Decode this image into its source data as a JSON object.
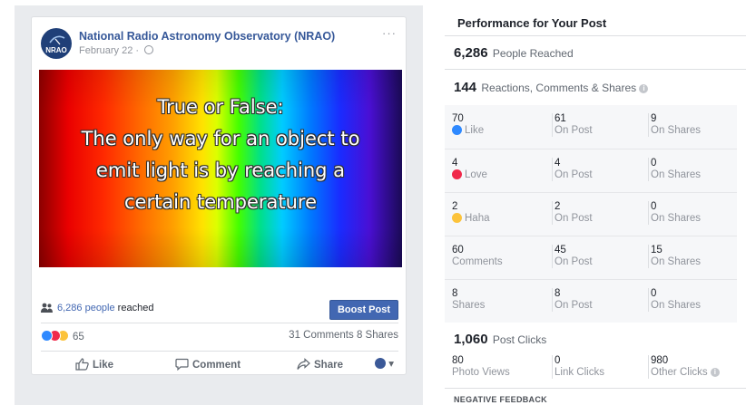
{
  "post": {
    "page_name": "National Radio Astronomy Observatory (NRAO)",
    "date": "February 22 · ",
    "avatar_text": "NRAO",
    "more_label": "···",
    "image_text": [
      "True or False:",
      "The only way for an object to",
      "emit light is by reaching a",
      "certain temperature"
    ],
    "reach_count": "6,286 people",
    "reach_suffix": " reached",
    "boost_label": "Boost Post",
    "reaction_total": "65",
    "comments_label": "31 Comments",
    "shares_label": "8 Shares",
    "like_label": "Like",
    "comment_label": "Comment",
    "share_label": "Share"
  },
  "performance": {
    "title": "Performance for Your Post",
    "people_reached": "6,286",
    "people_reached_label": "People Reached",
    "engagement_total": "144",
    "engagement_label": "Reactions, Comments & Shares",
    "rows": [
      {
        "n1": "70",
        "l1": "Like",
        "icon": "like",
        "n2": "61",
        "l2": "On Post",
        "n3": "9",
        "l3": "On Shares"
      },
      {
        "n1": "4",
        "l1": "Love",
        "icon": "love",
        "n2": "4",
        "l2": "On Post",
        "n3": "0",
        "l3": "On Shares"
      },
      {
        "n1": "2",
        "l1": "Haha",
        "icon": "haha",
        "n2": "2",
        "l2": "On Post",
        "n3": "0",
        "l3": "On Shares"
      },
      {
        "n1": "60",
        "l1": "Comments",
        "icon": "",
        "n2": "45",
        "l2": "On Post",
        "n3": "15",
        "l3": "On Shares"
      },
      {
        "n1": "8",
        "l1": "Shares",
        "icon": "",
        "n2": "8",
        "l2": "On Post",
        "n3": "0",
        "l3": "On Shares"
      }
    ],
    "post_clicks": "1,060",
    "post_clicks_label": "Post Clicks",
    "photo_views": "80",
    "photo_views_label": "Photo Views",
    "link_clicks": "0",
    "link_clicks_label": "Link Clicks",
    "other_clicks": "980",
    "other_clicks_label": "Other Clicks",
    "negative_feedback_title": "NEGATIVE FEEDBACK",
    "info_glyph": "i"
  },
  "colors": {
    "facebook_blue": "#4267b2",
    "link_blue": "#365899",
    "like_blue": "#2e89ff",
    "love_red": "#f0284a",
    "haha_yellow": "#fcc33b"
  },
  "icons": {
    "avatar": "nrao-logo-icon",
    "privacy": "globe-icon",
    "reach": "people-icon",
    "like": "thumbs-up-icon",
    "comment": "speech-bubble-icon",
    "share": "share-arrow-icon",
    "info": "info-icon"
  }
}
